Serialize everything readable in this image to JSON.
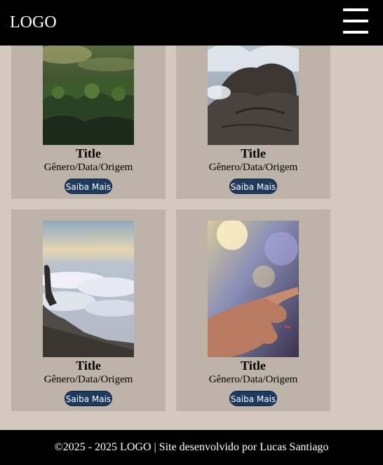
{
  "header": {
    "logo": "LOGO",
    "menu_icon": "hamburger-menu-icon"
  },
  "cards": [
    {
      "title": "Title",
      "meta": "Gênero/Data/Origem",
      "button": "Saiba Mais",
      "image": "forest-mist-photo"
    },
    {
      "title": "Title",
      "meta": "Gênero/Data/Origem",
      "button": "Saiba Mais",
      "image": "rocky-shore-waves-photo"
    },
    {
      "title": "Title",
      "meta": "Gênero/Data/Origem",
      "button": "Saiba Mais",
      "image": "person-above-clouds-photo"
    },
    {
      "title": "Title",
      "meta": "Gênero/Data/Origem",
      "button": "Saiba Mais",
      "image": "hand-bokeh-photo"
    }
  ],
  "footer": {
    "text": "©2025 - 2025 LOGO | Site desenvolvido por Lucas Santiago"
  },
  "colors": {
    "page_bg": "#d4c9be",
    "card_bg": "#bdb3a8",
    "button_bg": "#1e3a5f",
    "bar_bg": "#000000"
  }
}
